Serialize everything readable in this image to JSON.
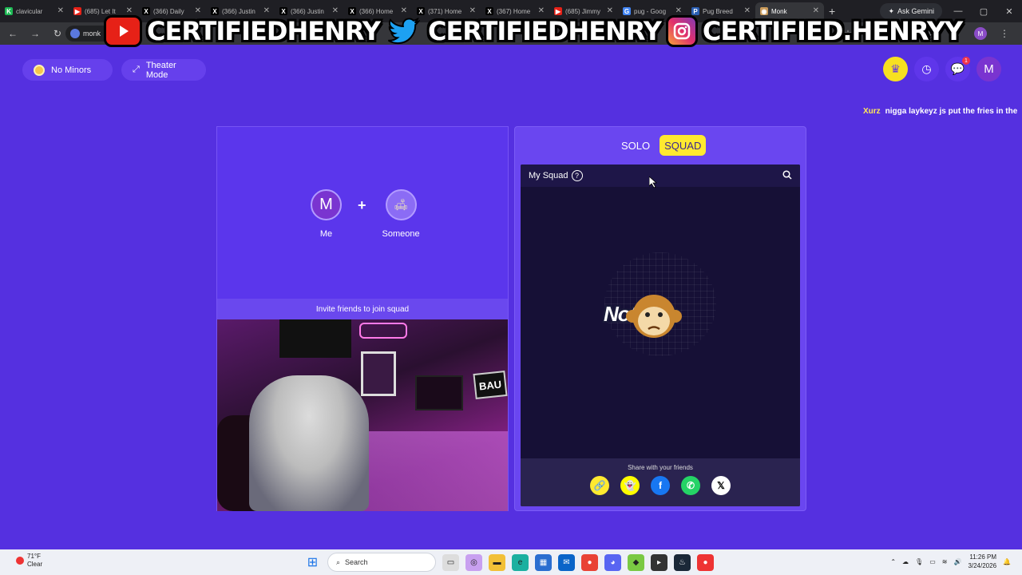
{
  "browser": {
    "tabs": [
      {
        "label": "clavicular",
        "color": "#1db954",
        "glyph": "K"
      },
      {
        "label": "(685) Let It",
        "color": "#e62117",
        "glyph": "▶"
      },
      {
        "label": "(366) Daily",
        "color": "#000000",
        "glyph": "X"
      },
      {
        "label": "(366) Justin",
        "color": "#000000",
        "glyph": "X"
      },
      {
        "label": "(366) Justin",
        "color": "#000000",
        "glyph": "X"
      },
      {
        "label": "(366) Home",
        "color": "#000000",
        "glyph": "X"
      },
      {
        "label": "(371) Home",
        "color": "#000000",
        "glyph": "X"
      },
      {
        "label": "(367) Home",
        "color": "#000000",
        "glyph": "X"
      },
      {
        "label": "(685) Jimmy",
        "color": "#e62117",
        "glyph": "▶"
      },
      {
        "label": "pug - Goog",
        "color": "#4285f4",
        "glyph": "G"
      },
      {
        "label": "Pug Breed",
        "color": "#2b5fb4",
        "glyph": "P"
      },
      {
        "label": "Monk",
        "color": "#c99a5a",
        "glyph": "◉"
      }
    ],
    "gemini_label": "Ask Gemini",
    "omnibox_text": "monk"
  },
  "overlay": {
    "youtube_handle": "CERTIFIEDHENRY",
    "twitter_handle": "CERTIFIEDHENRY",
    "instagram_handle": "CERTIFIED.HENRYY"
  },
  "header": {
    "no_minors_label": "No Minors",
    "theater_mode_label": "Theater Mode",
    "notification_count": "1",
    "profile_initial": "M"
  },
  "marquee": {
    "user": "Xurz",
    "message": "nigga laykeyz js put the fries in the"
  },
  "left_panel": {
    "me_initial": "M",
    "me_label": "Me",
    "someone_label": "Someone",
    "invite_label": "Invite friends to join squad"
  },
  "right_panel": {
    "solo_label": "SOLO",
    "squad_label": "SQUAD",
    "my_squad_label": "My Squad",
    "empty_text": "Nothing",
    "share_label": "Share with your friends"
  },
  "taskbar": {
    "temperature": "71°F",
    "weather": "Clear",
    "search_label": "Search",
    "time": "11:26 PM",
    "date": "3/24/2026"
  },
  "colors": {
    "page_bg": "#5530e0",
    "accent_yellow": "#ffe930"
  }
}
